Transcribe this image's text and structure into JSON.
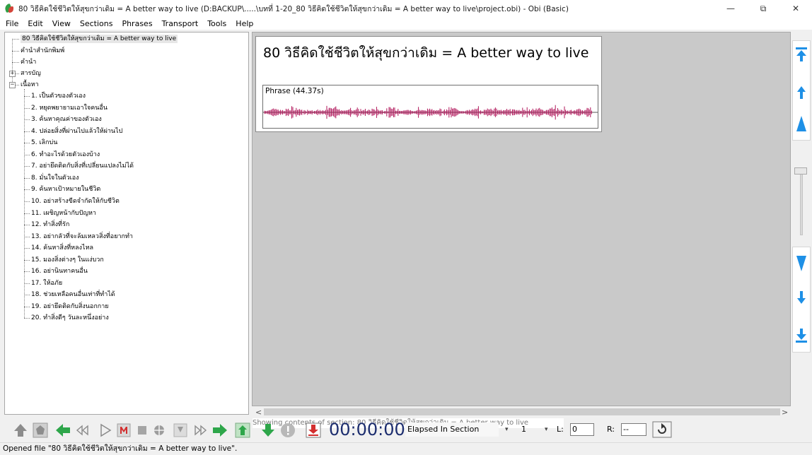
{
  "window": {
    "title": "80 วิธีคิดใช้ชีวิตให้สุขกว่าเดิม = A better way to live (D:BACKUP\\.....\\บทที่ 1-20_80 วิธีคิดใช้ชีวิตให้สุขกว่าเดิม = A better way to live\\project.obi) - Obi (Basic)",
    "minimize": "—",
    "maximize": "⧉",
    "close": "✕"
  },
  "menu": [
    "File",
    "Edit",
    "View",
    "Sections",
    "Phrases",
    "Transport",
    "Tools",
    "Help"
  ],
  "tree": {
    "root": "80 วิธีคิดใช้ชีวิตให้สุขกว่าเดิม = A better way to live",
    "top_level": [
      {
        "label": "คำนำสำนักพิมพ์",
        "expander": ""
      },
      {
        "label": "คำนำ",
        "expander": ""
      },
      {
        "label": "สารบัญ",
        "expander": "+"
      },
      {
        "label": "เนื้อหา",
        "expander": "−"
      }
    ],
    "children": [
      "1. เป็นตัวของตัวเอง",
      "2. หยุดพยายามเอาใจคนอื่น",
      "3. ค้นหาคุณค่าของตัวเอง",
      "4. ปล่อยสิ่งที่ผ่านไปแล้วให้ผ่านไป",
      "5. เลิกบ่น",
      "6. ทำอะไรด้วยตัวเองบ้าง",
      "7. อย่ายึดติดกับสิ่งที่เปลี่ยนแปลงไม่ได้",
      "8. มั่นใจในตัวเอง",
      "9. ค้นหาเป้าหมายในชีวิต",
      "10. อย่าสร้างขีดจำกัดให้กับชีวิต",
      "11. เผชิญหน้ากับปัญหา",
      "12. ทำสิ่งที่รัก",
      "13. อย่ากลัวที่จะล้มเหลวสิ่งที่อยากทำ",
      "14. ค้นหาสิ่งที่หลงไหล",
      "15. มองสิ่งต่างๆ ในแง่บวก",
      "16. อย่านินทาคนอื่น",
      "17. ให้อภัย",
      "18. ช่วยเหลือคนอื่นเท่าที่ทำได้",
      "19. อย่ายึดติดกับสิ่งนอกกาย",
      "20. ทำสิ่งดีๆ วันละหนึ่งอย่าง"
    ]
  },
  "content": {
    "section_title": "80 วิธีคิดใช้ชีวิตให้สุขกว่าเดิม = A better way to live",
    "phrase_label": "Phrase (44.37s)",
    "section_status": "Showing contents of section:  80 วิธีคิดใช้ชีวิตให้สุขกว่าเดิม = A better way to live"
  },
  "scroll": {
    "left": "<",
    "right": ">"
  },
  "transport": {
    "time": "00:00:00",
    "time_mode": "Elapsed In Section",
    "level_value": "1",
    "l_label": "L:",
    "l_value": "0",
    "r_label": "R:",
    "r_value": "--"
  },
  "status_bar": "Opened file \"80 วิธีคิดใช้ชีวิตให้สุขกว่าเดิม = A better way to live\".",
  "colors": {
    "waveform": "#b0155a",
    "nav_blue": "#1e90e6",
    "toolbar_green": "#2ea64a",
    "toolbar_red": "#d32f2f",
    "time_text": "#1c2d6e"
  }
}
